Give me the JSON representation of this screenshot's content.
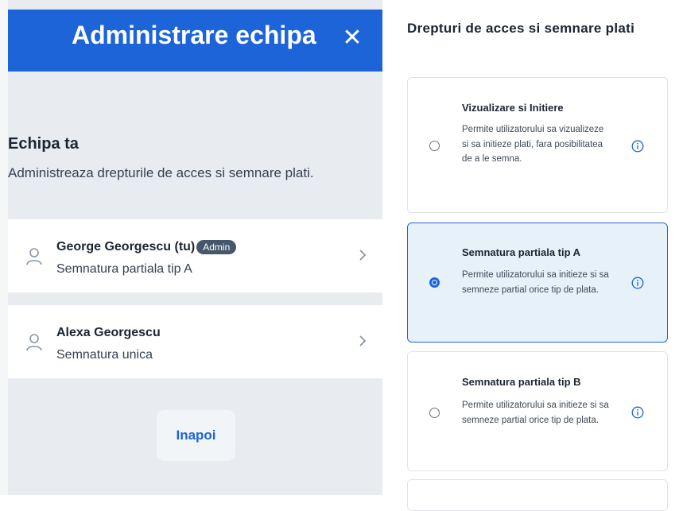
{
  "left_panel": {
    "title": "Administrare echipa",
    "close_icon": "close-icon",
    "team_title": "Echipa ta",
    "team_subtitle": "Administreaza drepturile de acces si semnare plati.",
    "members": [
      {
        "name": "George Georgescu (tu)",
        "badge": "Admin",
        "role": "Semnatura partiala tip A"
      },
      {
        "name": "Alexa Georgescu",
        "badge": "",
        "role": "Semnatura unica"
      }
    ],
    "back_label": "Inapoi"
  },
  "right_panel": {
    "title": "Drepturi de acces si semnare plati",
    "options": [
      {
        "title": "Vizualizare si Initiere",
        "desc": "Permite utilizatorului sa vizualizeze si sa initieze plati, fara posibilitatea de a le semna.",
        "selected": false
      },
      {
        "title": "Semnatura partiala tip A",
        "desc": "Permite utilizatorului sa initieze si sa semneze partial orice tip de plata.",
        "selected": true
      },
      {
        "title": "Semnatura partiala tip B",
        "desc": "Permite utilizatorului sa initieze si sa semneze partial orice tip de plata.",
        "selected": false
      }
    ]
  },
  "colors": {
    "accent": "#1c64d8",
    "selected_bg": "#e6f1fa",
    "badge_bg": "#46566b",
    "panel_bg": "#e8ecf1"
  }
}
